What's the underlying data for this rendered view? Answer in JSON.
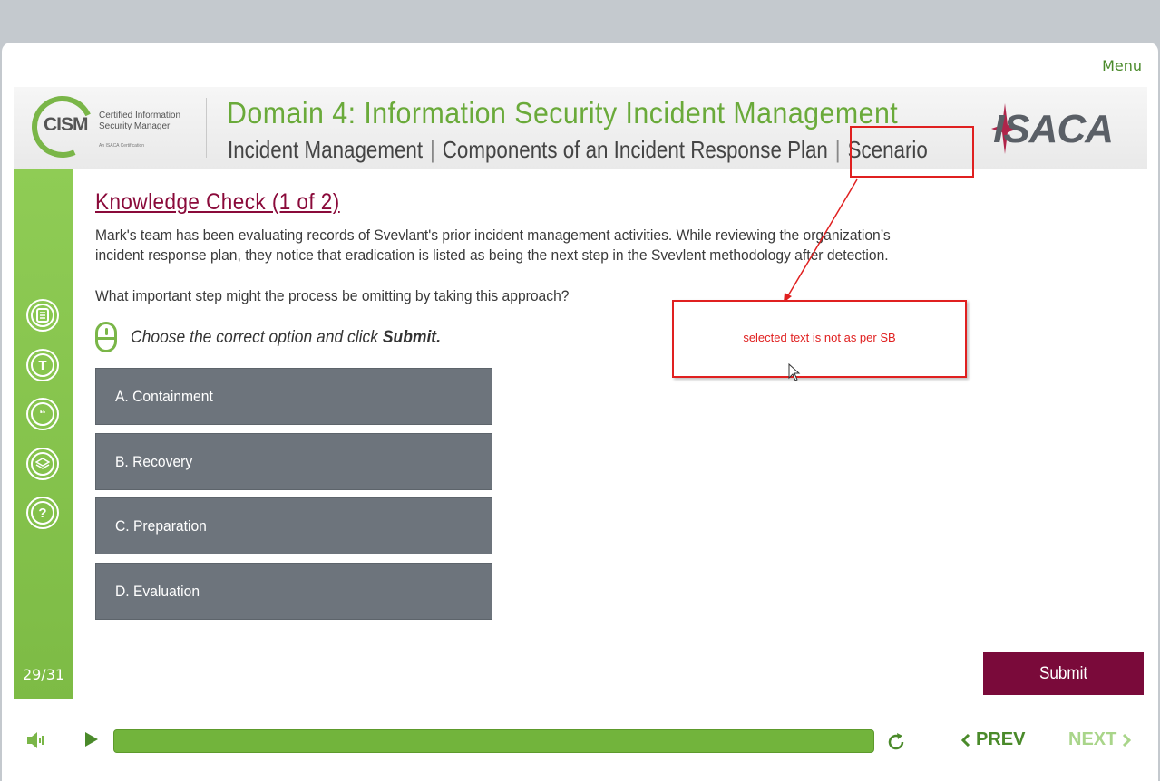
{
  "menu_label": "Menu",
  "header": {
    "logo_word": "CISM",
    "logo_sub": "Certified Information Security Manager",
    "logo_sub2": "An ISACA Certification",
    "title": "Domain 4: Information Security Incident Management",
    "breadcrumb_a": "Incident Management",
    "breadcrumb_b": "Components of an Incident Response Plan",
    "breadcrumb_c": "Scenario",
    "brand": "ISACA"
  },
  "sidebar": {
    "icons": [
      "notes-icon",
      "transcript-icon",
      "quote-icon",
      "layers-icon",
      "help-icon"
    ],
    "page_count": "29/31"
  },
  "content": {
    "title": "Knowledge Check (1 of 2)",
    "paragraph": "Mark's team has been evaluating records of Svevlant's prior incident management activities. While reviewing the organization’s incident response plan, they notice that eradication is listed as being the next step in the Svevlent methodology after detection.",
    "question": "What important step might the process be omitting by taking this approach?",
    "instruction_prefix": "Choose the correct option and click",
    "instruction_action": "Submit.",
    "options": [
      {
        "label": "A. Containment"
      },
      {
        "label": "B. Recovery"
      },
      {
        "label": "C. Preparation"
      },
      {
        "label": "D. Evaluation"
      }
    ],
    "submit_label": "Submit"
  },
  "annotation": {
    "text": "selected text is not as per SB",
    "color": "#e02020"
  },
  "controls": {
    "progress": 1.0,
    "prev_label": "PREV",
    "next_label": "NEXT"
  },
  "colors": {
    "accent_green": "#7ab648",
    "maroon": "#7a0a3a",
    "option_gray": "#6d747c"
  }
}
